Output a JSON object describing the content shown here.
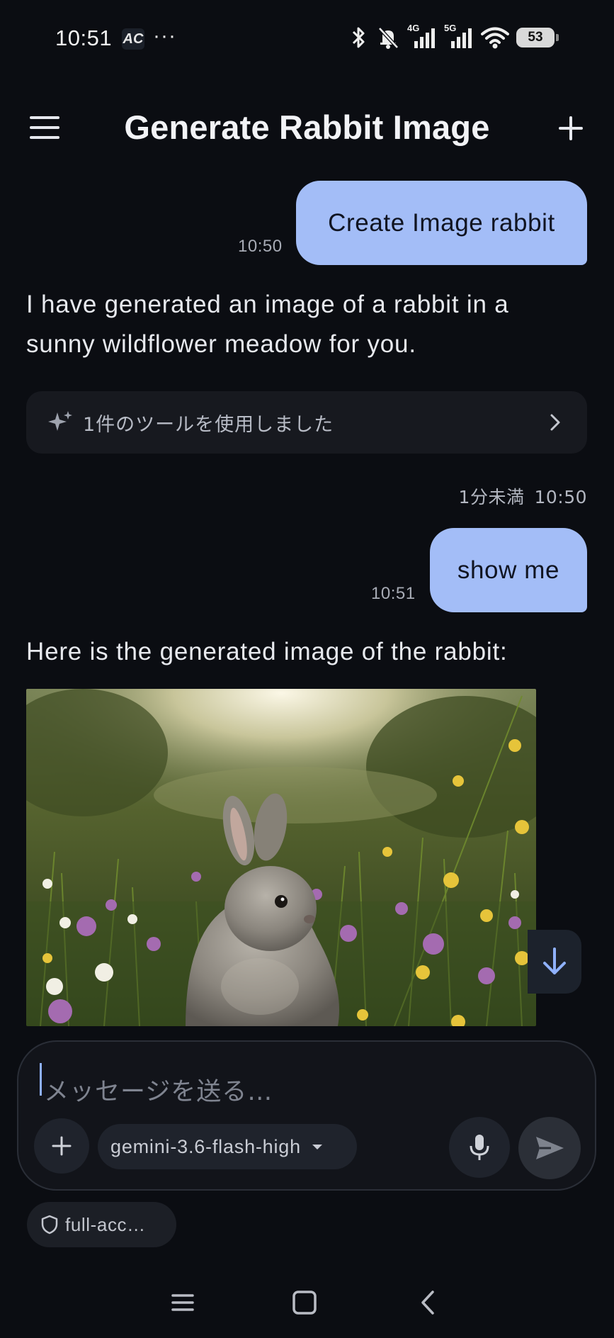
{
  "status_bar": {
    "time": "10:51",
    "app_icon_text": "AC",
    "overflow": "···",
    "network_4g": "4G",
    "network_5g": "5G",
    "battery": "53"
  },
  "header": {
    "title": "Generate Rabbit Image"
  },
  "messages": {
    "user_1": {
      "text": "Create Image rabbit",
      "time": "10:50"
    },
    "assistant_1": {
      "text": "I have generated an image of a rabbit in a sunny wildflower meadow for you."
    },
    "tool_card": {
      "label": "1件のツールを使用しました"
    },
    "assistant_1_meta": {
      "duration": "1分未満",
      "time": "10:50"
    },
    "user_2": {
      "text": "show me",
      "time": "10:51"
    },
    "assistant_2": {
      "text": "Here is the generated image of the rabbit:"
    }
  },
  "composer": {
    "placeholder": "メッセージを送る…",
    "model": "gemini-3.6-flash-high"
  },
  "access_chip": {
    "label": "full-acc…"
  },
  "colors": {
    "background": "#0b0d12",
    "user_bubble": "#a3bdf7",
    "accent": "#8fb1ff"
  }
}
